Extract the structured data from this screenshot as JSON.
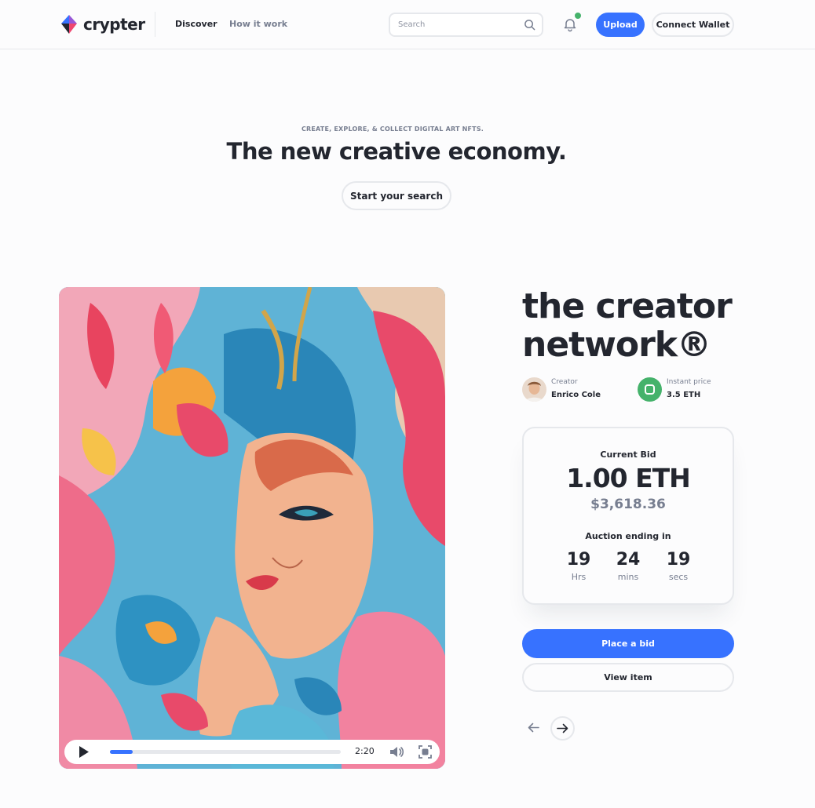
{
  "header": {
    "logo_text": "crypter",
    "nav": [
      {
        "label": "Discover"
      },
      {
        "label": "How it work"
      }
    ],
    "search_placeholder": "Search",
    "upload_label": "Upload",
    "connect_wallet_label": "Connect Wallet",
    "notification_unread": true
  },
  "hero": {
    "subtitle": "CREATE, EXPLORE, & COLLECT DIGITAL ART NFTS.",
    "title": "The new creative economy.",
    "cta_label": "Start your search"
  },
  "player": {
    "time": "2:20",
    "progress": 0.1
  },
  "item": {
    "title": "the creator network®",
    "creator_label": "Creator",
    "creator_name": "Enrico Cole",
    "instant_price_label": "Instant price",
    "instant_price_value": "3.5 ETH"
  },
  "bid": {
    "label": "Current Bid",
    "eth": "1.00 ETH",
    "usd": "$3,618.36",
    "auction_label": "Auction ending in",
    "timer": [
      {
        "value": "19",
        "unit": "Hrs"
      },
      {
        "value": "24",
        "unit": "mins"
      },
      {
        "value": "19",
        "unit": "secs"
      }
    ]
  },
  "actions": {
    "place_bid_label": "Place a bid",
    "view_item_label": "View item"
  },
  "colors": {
    "primary": "#3772ff",
    "success": "#45b26b",
    "text": "#23262f",
    "muted": "#777e90",
    "border": "#e6e8ec"
  },
  "icons": [
    "logo-icon",
    "search-icon",
    "bell-icon",
    "play-icon",
    "volume-icon",
    "fullscreen-icon",
    "arrow-left-icon",
    "arrow-right-icon"
  ]
}
